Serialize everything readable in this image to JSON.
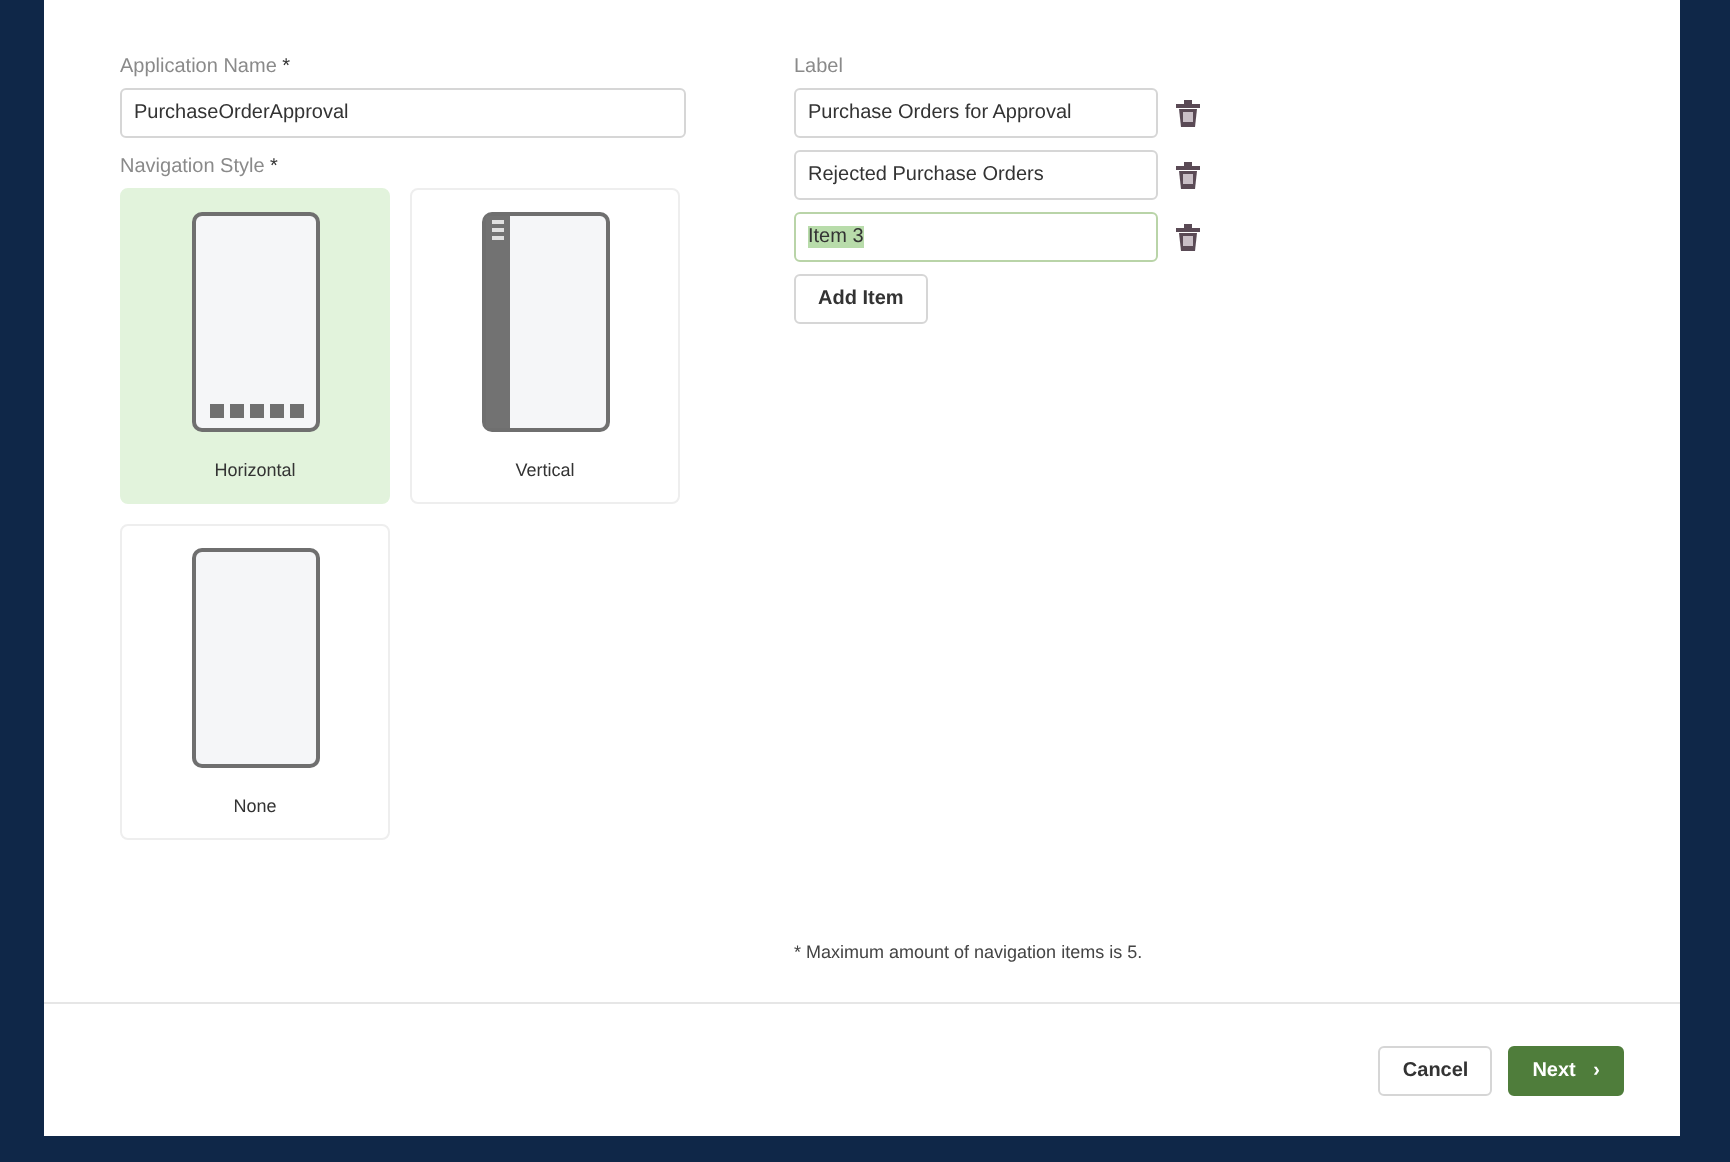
{
  "application_name": {
    "label": "Application Name",
    "required_mark": "*",
    "value": "PurchaseOrderApproval"
  },
  "navigation_style": {
    "label": "Navigation Style",
    "required_mark": "*",
    "options": [
      {
        "kind": "horizontal",
        "label": "Horizontal",
        "selected": true
      },
      {
        "kind": "vertical",
        "label": "Vertical",
        "selected": false
      },
      {
        "kind": "none",
        "label": "None",
        "selected": false
      }
    ]
  },
  "items": {
    "label": "Label",
    "rows": [
      {
        "value": "Purchase Orders for Approval",
        "focused": false
      },
      {
        "value": "Rejected Purchase Orders",
        "focused": false
      },
      {
        "value": "Item 3",
        "focused": true
      }
    ],
    "add_button": "Add Item"
  },
  "note": "* Maximum amount of navigation items is 5.",
  "buttons": {
    "cancel": "Cancel",
    "next": "Next",
    "next_icon": "›"
  }
}
